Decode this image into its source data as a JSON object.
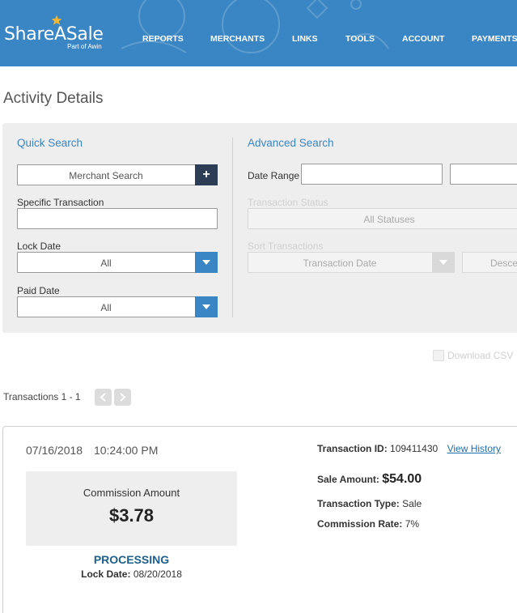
{
  "header": {
    "logo_text": "ShareASale",
    "logo_sub": "Part of Awin",
    "nav": [
      "REPORTS",
      "MERCHANTS",
      "LINKS",
      "TOOLS",
      "ACCOUNT",
      "PAYMENTS"
    ],
    "colors": {
      "bar": "#3a86c4",
      "star": "#f2b632"
    }
  },
  "page": {
    "title": "Activity Details"
  },
  "quick_search": {
    "heading": "Quick Search",
    "merchant_search_label": "Merchant Search",
    "plus_label": "+",
    "specific_transaction_label": "Specific Transaction",
    "specific_transaction_value": "",
    "lock_date_label": "Lock Date",
    "lock_date_value": "All",
    "paid_date_label": "Paid Date",
    "paid_date_value": "All"
  },
  "advanced_search": {
    "heading": "Advanced Search",
    "date_range_label": "Date Range",
    "date_from_value": "",
    "date_to_value": "",
    "transaction_status_label": "Transaction Status",
    "transaction_status_value": "All Statuses",
    "sort_label": "Sort Transactions",
    "sort_field_value": "Transaction Date",
    "sort_order_value": "Desce"
  },
  "download_csv_label": "Download CSV",
  "pager": {
    "label": "Transactions 1 - 1"
  },
  "transaction": {
    "date": "07/16/2018",
    "time": "10:24:00 PM",
    "commission_label": "Commission Amount",
    "commission_value": "$3.78",
    "status": "PROCESSING",
    "lock_date_label": "Lock Date:",
    "lock_date_value": "08/20/2018",
    "transaction_id_label": "Transaction ID:",
    "transaction_id_value": "109411430",
    "view_history_label": "View History",
    "sale_amount_label": "Sale Amount:",
    "sale_amount_value": "$54.00",
    "transaction_type_label": "Transaction Type:",
    "transaction_type_value": "Sale",
    "commission_rate_label": "Commission Rate:",
    "commission_rate_value": "7%"
  }
}
